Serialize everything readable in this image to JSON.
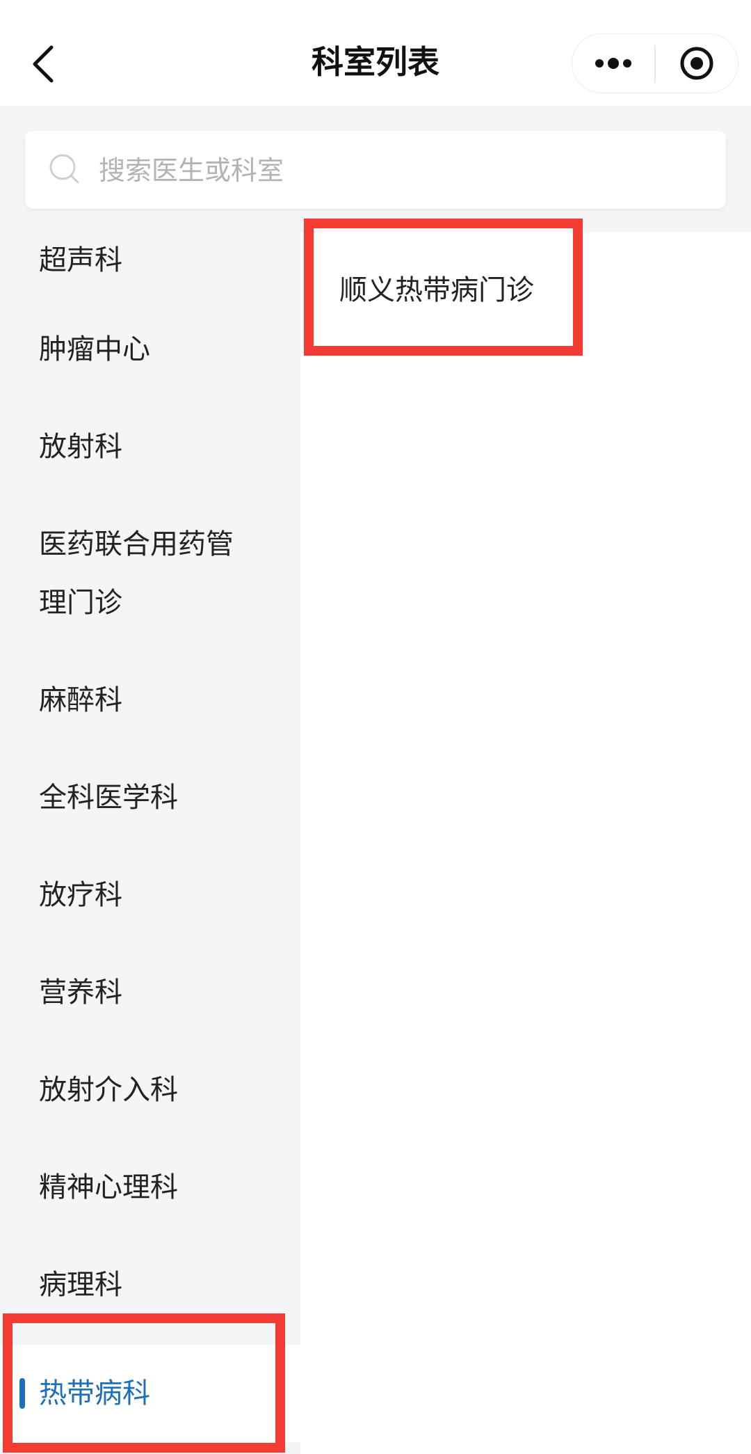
{
  "header": {
    "title": "科室列表",
    "back_icon": "chevron-left-icon",
    "more_icon": "more-dots-icon",
    "close_icon": "target-close-icon"
  },
  "search": {
    "placeholder": "搜索医生或科室",
    "icon": "search-icon"
  },
  "sidebar": {
    "items": [
      {
        "label": "超声科"
      },
      {
        "label": "肿瘤中心"
      },
      {
        "label": "放射科"
      },
      {
        "label": "医药联合用药管理门诊"
      },
      {
        "label": "麻醉科"
      },
      {
        "label": "全科医学科"
      },
      {
        "label": "放疗科"
      },
      {
        "label": "营养科"
      },
      {
        "label": "放射介入科"
      },
      {
        "label": "精神心理科"
      },
      {
        "label": "病理科"
      },
      {
        "label": "热带病科",
        "active": true
      }
    ]
  },
  "content": {
    "departments": [
      {
        "label": "顺义热带病门诊"
      }
    ]
  },
  "colors": {
    "accent": "#1d6fb8",
    "highlight": "#f33a33",
    "sidebar_bg": "#f4f5f7"
  }
}
